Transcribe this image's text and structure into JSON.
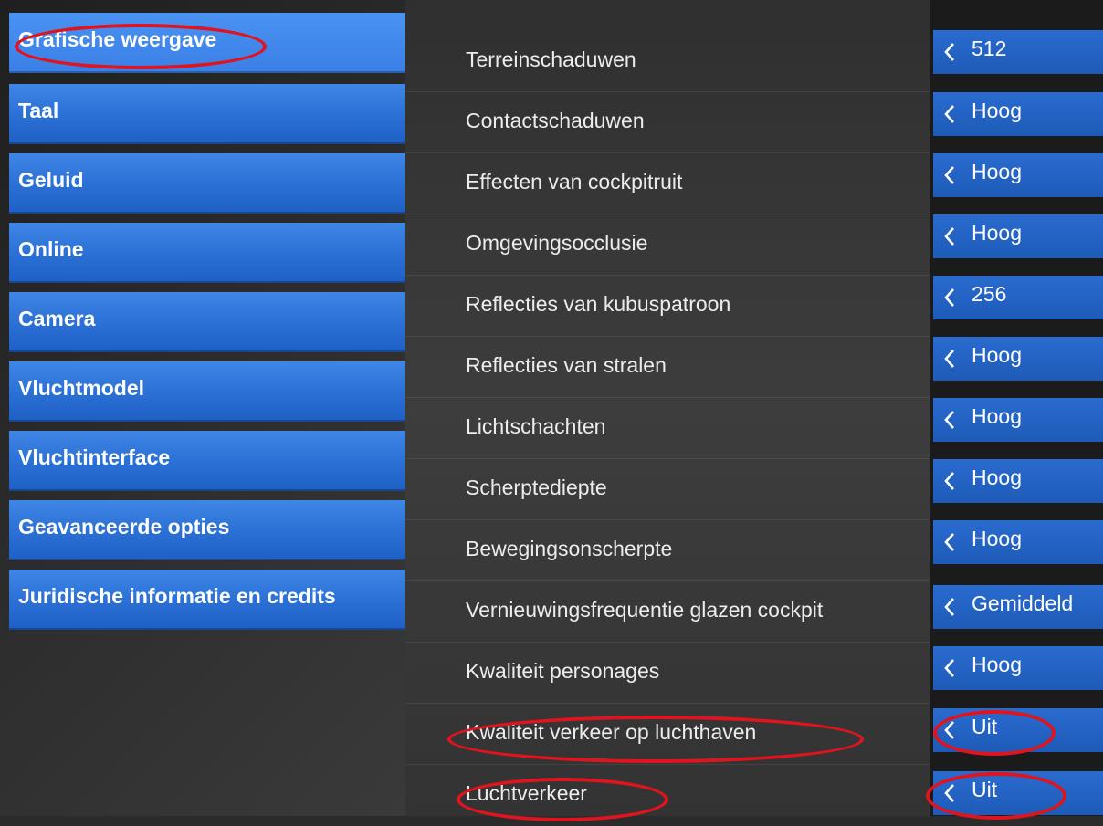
{
  "sidebar": {
    "items": [
      {
        "label": "Grafische weergave"
      },
      {
        "label": "Taal"
      },
      {
        "label": "Geluid"
      },
      {
        "label": "Online"
      },
      {
        "label": "Camera"
      },
      {
        "label": "Vluchtmodel"
      },
      {
        "label": "Vluchtinterface"
      },
      {
        "label": "Geavanceerde opties"
      },
      {
        "label": "Juridische informatie en credits"
      }
    ]
  },
  "settings": [
    {
      "label": "Terreinschaduwen",
      "value": "512"
    },
    {
      "label": "Contactschaduwen",
      "value": "Hoog"
    },
    {
      "label": "Effecten van cockpitruit",
      "value": "Hoog"
    },
    {
      "label": "Omgevingsocclusie",
      "value": "Hoog"
    },
    {
      "label": "Reflecties van kubuspatroon",
      "value": "256"
    },
    {
      "label": "Reflecties van stralen",
      "value": "Hoog"
    },
    {
      "label": "Lichtschachten",
      "value": "Hoog"
    },
    {
      "label": "Scherptediepte",
      "value": "Hoog"
    },
    {
      "label": "Bewegingsonscherpte",
      "value": "Hoog"
    },
    {
      "label": "Vernieuwingsfrequentie glazen cockpit",
      "value": "Gemiddeld"
    },
    {
      "label": "Kwaliteit personages",
      "value": "Hoog"
    },
    {
      "label": "Kwaliteit verkeer op luchthaven",
      "value": "Uit"
    },
    {
      "label": "Luchtverkeer",
      "value": "Uit"
    }
  ],
  "icons": {
    "value_decrease": "chevron-left-icon"
  },
  "colors": {
    "accent": "#2a6fd4",
    "annotation": "#e0141e"
  }
}
